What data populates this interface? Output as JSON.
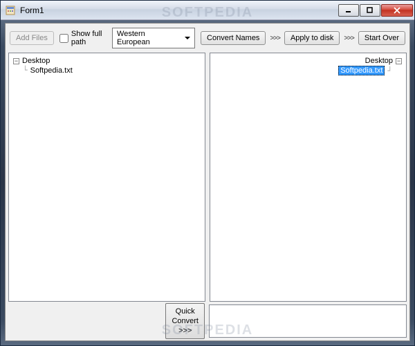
{
  "window": {
    "title": "Form1"
  },
  "toolbar": {
    "add_files_label": "Add Files",
    "show_full_path_label": "Show full path",
    "show_full_path_checked": false,
    "encoding_selected": "Western European",
    "convert_names_label": "Convert Names",
    "apply_to_disk_label": "Apply to disk",
    "start_over_label": "Start Over",
    "arrows": ">>>"
  },
  "left_tree": {
    "root": "Desktop",
    "items": [
      "Softpedia.txt"
    ]
  },
  "right_tree": {
    "root": "Desktop",
    "items": [
      "Softpedia.txt"
    ],
    "selected_index": 0
  },
  "bottom": {
    "quick_convert_label": "Quick\nConvert\n>>>"
  },
  "watermark": "SOFTPEDIA"
}
